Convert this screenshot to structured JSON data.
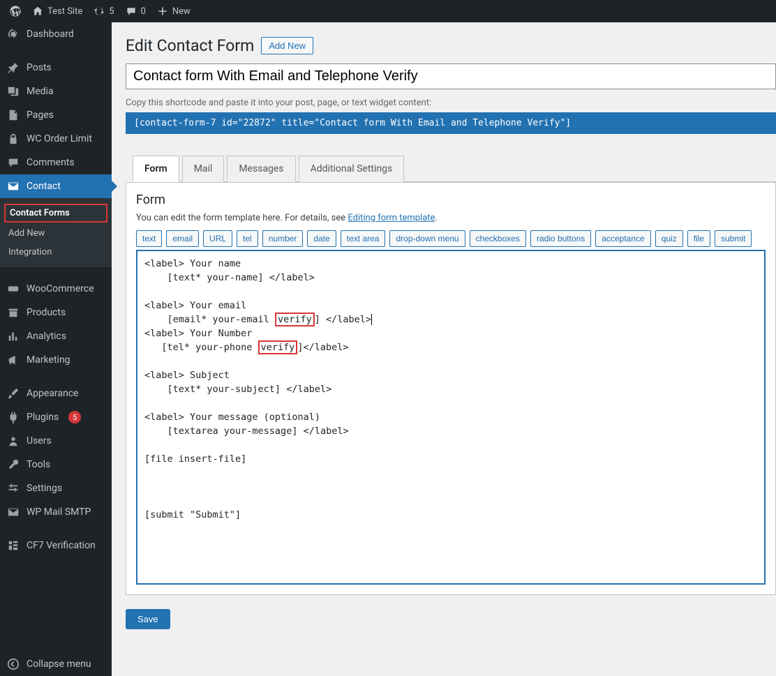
{
  "adminbar": {
    "site_name": "Test Site",
    "updates_count": "5",
    "comments_count": "0",
    "new_label": "New"
  },
  "sidebar": {
    "dashboard": "Dashboard",
    "posts": "Posts",
    "media": "Media",
    "pages": "Pages",
    "wc_order_limit": "WC Order Limit",
    "comments": "Comments",
    "contact": "Contact",
    "contact_sub": {
      "forms": "Contact Forms",
      "add_new": "Add New",
      "integration": "Integration"
    },
    "woocommerce": "WooCommerce",
    "products": "Products",
    "analytics": "Analytics",
    "marketing": "Marketing",
    "appearance": "Appearance",
    "plugins": "Plugins",
    "plugins_badge": "5",
    "users": "Users",
    "tools": "Tools",
    "settings": "Settings",
    "wp_mail_smtp": "WP Mail SMTP",
    "cf7_verification": "CF7 Verification",
    "collapse": "Collapse menu"
  },
  "page": {
    "title": "Edit Contact Form",
    "add_new": "Add New",
    "form_title_value": "Contact form With Email and Telephone Verify",
    "shortcode_label": "Copy this shortcode and paste it into your post, page, or text widget content:",
    "shortcode_value": "[contact-form-7 id=\"22872\" title=\"Contact form With Email and Telephone Verify\"]"
  },
  "tabs": [
    "Form",
    "Mail",
    "Messages",
    "Additional Settings"
  ],
  "form_panel": {
    "heading": "Form",
    "desc_prefix": "You can edit the form template here. For details, see ",
    "desc_link": "Editing form template",
    "desc_suffix": "."
  },
  "tag_buttons": [
    "text",
    "email",
    "URL",
    "tel",
    "number",
    "date",
    "text area",
    "drop-down menu",
    "checkboxes",
    "radio buttons",
    "acceptance",
    "quiz",
    "file",
    "submit"
  ],
  "code_lines": {
    "l1": "<label> Your name",
    "l2": "    [text* your-name] </label>",
    "l3": "",
    "l4": "<label> Your email",
    "l5a": "    [email* your-email ",
    "l5b": "verify",
    "l5c": "] </label>",
    "l6": "<label> Your Number",
    "l7a": "   [tel* your-phone ",
    "l7b": "verify",
    "l7c": "]</label>",
    "l8": "",
    "l9": "<label> Subject",
    "l10": "    [text* your-subject] </label>",
    "l11": "",
    "l12": "<label> Your message (optional)",
    "l13": "    [textarea your-message] </label>",
    "l14": "",
    "l15": "[file insert-file]",
    "l16": "",
    "l17": "",
    "l18": "",
    "l19": "[submit \"Submit\"]"
  },
  "save_label": "Save"
}
